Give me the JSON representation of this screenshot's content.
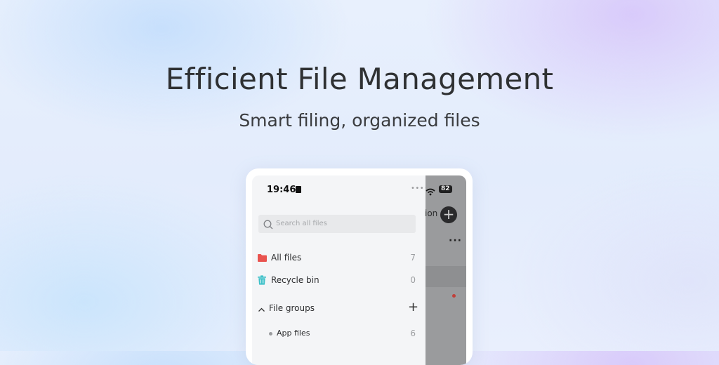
{
  "promo": {
    "headline": "Efficient File Management",
    "subhead": "Smart filing, organized files"
  },
  "status_bar": {
    "time": "19:46",
    "battery": "82"
  },
  "search": {
    "placeholder": "Search all files"
  },
  "sidebar": {
    "items": [
      {
        "label": "All files",
        "count": "7",
        "icon": "folder-icon",
        "icon_color": "#e9534f"
      },
      {
        "label": "Recycle bin",
        "count": "0",
        "icon": "trash-icon",
        "icon_color": "#3fc1c9"
      }
    ],
    "group": {
      "label": "File groups",
      "children": [
        {
          "label": "App files",
          "count": "6"
        }
      ]
    }
  },
  "background_panel": {
    "peek_text": "ion"
  }
}
